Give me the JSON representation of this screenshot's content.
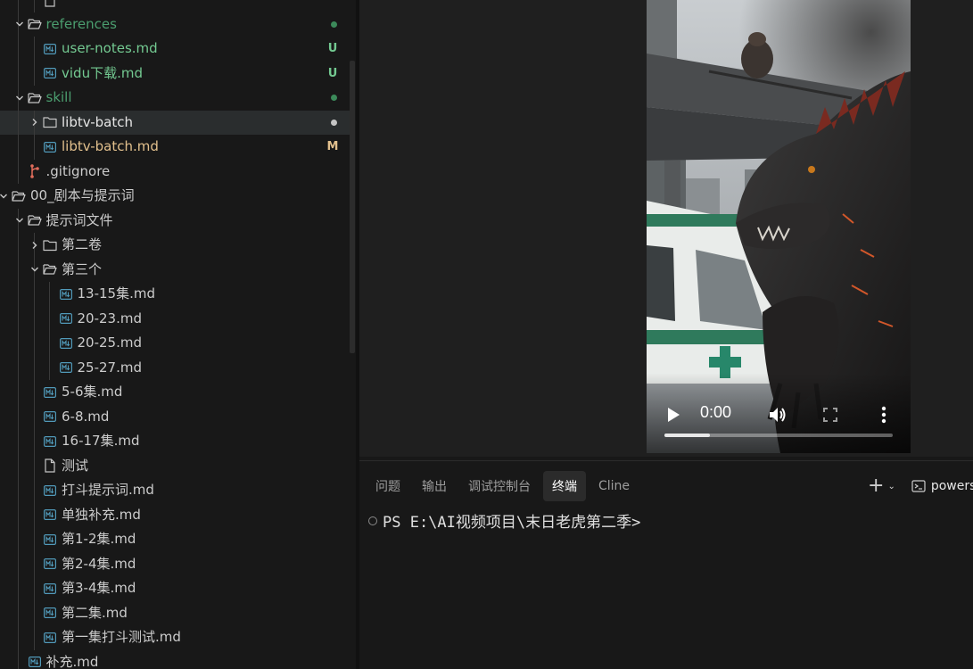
{
  "explorer": {
    "items": [
      {
        "id": "references-child-hidden",
        "label": "",
        "depth": 2,
        "kind": "file",
        "color": "plain"
      },
      {
        "id": "references",
        "label": "references",
        "depth": 1,
        "kind": "folder",
        "open": true,
        "color": "teal",
        "dot": "#3c8a5a"
      },
      {
        "id": "user-notes-md",
        "label": "user-notes.md",
        "depth": 2,
        "kind": "md",
        "color": "green",
        "badge": "U",
        "badge_color": "#73c991"
      },
      {
        "id": "vidu-md",
        "label": "vidu下载.md",
        "depth": 2,
        "kind": "md",
        "color": "green",
        "badge": "U",
        "badge_color": "#73c991"
      },
      {
        "id": "skill",
        "label": "skill",
        "depth": 1,
        "kind": "folder",
        "open": true,
        "color": "teal",
        "dot": "#3c8a5a"
      },
      {
        "id": "libtv-batch",
        "label": "libtv-batch",
        "depth": 2,
        "kind": "folder",
        "open": false,
        "color": "white",
        "dot": "#c5c5c5",
        "selected": true
      },
      {
        "id": "libtv-batch-md",
        "label": "libtv-batch.md",
        "depth": 2,
        "kind": "md",
        "color": "yellow",
        "badge": "M",
        "badge_color": "#e2c08d"
      },
      {
        "id": "gitignore",
        "label": ".gitignore",
        "depth": 1,
        "kind": "git",
        "color": "plain"
      },
      {
        "id": "script-prompts",
        "label": "00_剧本与提示词",
        "depth": 0,
        "kind": "folder",
        "open": true,
        "color": "plain"
      },
      {
        "id": "prompt-files",
        "label": "提示词文件",
        "depth": 1,
        "kind": "folder",
        "open": true,
        "color": "plain"
      },
      {
        "id": "vol-2",
        "label": "第二卷",
        "depth": 2,
        "kind": "folder",
        "open": false,
        "color": "plain"
      },
      {
        "id": "third",
        "label": "第三个",
        "depth": 2,
        "kind": "folder",
        "open": true,
        "color": "plain"
      },
      {
        "id": "ep13-15",
        "label": "13-15集.md",
        "depth": 3,
        "kind": "md",
        "color": "plain"
      },
      {
        "id": "ep20-23",
        "label": "20-23.md",
        "depth": 3,
        "kind": "md",
        "color": "plain"
      },
      {
        "id": "ep20-25",
        "label": "20-25.md",
        "depth": 3,
        "kind": "md",
        "color": "plain"
      },
      {
        "id": "ep25-27",
        "label": "25-27.md",
        "depth": 3,
        "kind": "md",
        "color": "plain"
      },
      {
        "id": "ep5-6",
        "label": "5-6集.md",
        "depth": 2,
        "kind": "md",
        "color": "plain"
      },
      {
        "id": "ep6-8",
        "label": "6-8.md",
        "depth": 2,
        "kind": "md",
        "color": "plain"
      },
      {
        "id": "ep16-17",
        "label": "16-17集.md",
        "depth": 2,
        "kind": "md",
        "color": "plain"
      },
      {
        "id": "test",
        "label": "测试",
        "depth": 2,
        "kind": "file",
        "color": "plain"
      },
      {
        "id": "fight-prompts",
        "label": "打斗提示词.md",
        "depth": 2,
        "kind": "md",
        "color": "plain"
      },
      {
        "id": "supplement-single",
        "label": "单独补充.md",
        "depth": 2,
        "kind": "md",
        "color": "plain"
      },
      {
        "id": "ep1-2",
        "label": "第1-2集.md",
        "depth": 2,
        "kind": "md",
        "color": "plain"
      },
      {
        "id": "ep2-4",
        "label": "第2-4集.md",
        "depth": 2,
        "kind": "md",
        "color": "plain"
      },
      {
        "id": "ep3-4",
        "label": "第3-4集.md",
        "depth": 2,
        "kind": "md",
        "color": "plain"
      },
      {
        "id": "ep2",
        "label": "第二集.md",
        "depth": 2,
        "kind": "md",
        "color": "plain"
      },
      {
        "id": "ep1-fight-test",
        "label": "第一集打斗测试.md",
        "depth": 2,
        "kind": "md",
        "color": "plain"
      },
      {
        "id": "supplement",
        "label": "补充.md",
        "depth": 1,
        "kind": "md",
        "color": "plain"
      }
    ]
  },
  "video": {
    "time": "0:00",
    "progress": 0.2
  },
  "panel": {
    "tabs": [
      {
        "label": "问题",
        "active": false
      },
      {
        "label": "输出",
        "active": false
      },
      {
        "label": "调试控制台",
        "active": false
      },
      {
        "label": "终端",
        "active": true
      },
      {
        "label": "Cline",
        "active": false
      }
    ],
    "terminal_name": "powers",
    "prompt": "PS E:\\AI视频项目\\末日老虎第二季>"
  },
  "colors": {
    "green": "#73c991",
    "teal": "#4b9e6f",
    "yellow": "#e2c08d",
    "white": "#e6e6e6",
    "plain": "#cccccc",
    "md_icon": "#519aba"
  }
}
